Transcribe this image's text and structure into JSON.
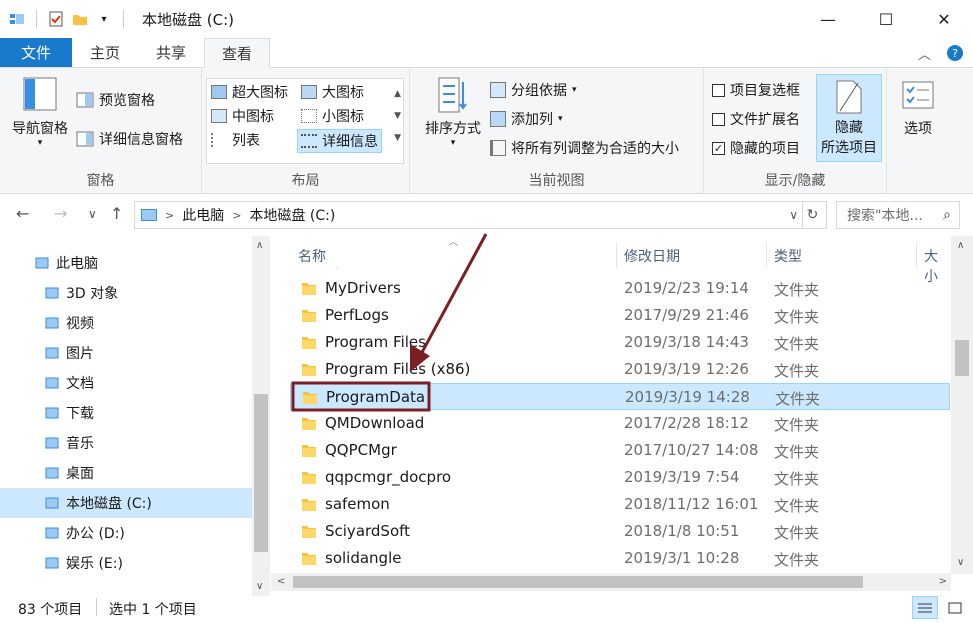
{
  "window": {
    "title": "本地磁盘 (C:)",
    "minimize": "—",
    "maximize": "☐",
    "close": "✕"
  },
  "tabs": {
    "file": "文件",
    "home": "主页",
    "share": "共享",
    "view": "查看"
  },
  "ribbon": {
    "panes": {
      "nav_pane": "导航窗格",
      "preview_pane": "预览窗格",
      "details_pane": "详细信息窗格",
      "label": "窗格"
    },
    "layout": {
      "xl_icons": "超大图标",
      "large_icons": "大图标",
      "medium_icons": "中图标",
      "small_icons": "小图标",
      "list": "列表",
      "details": "详细信息",
      "label": "布局"
    },
    "current_view": {
      "sort_by": "排序方式",
      "group_by": "分组依据",
      "add_column": "添加列",
      "size_all": "将所有列调整为合适的大小",
      "label": "当前视图"
    },
    "show_hide": {
      "item_checkboxes": "项目复选框",
      "file_ext": "文件扩展名",
      "hidden_items": "隐藏的项目",
      "hide_selected_1": "隐藏",
      "hide_selected_2": "所选项目",
      "label": "显示/隐藏",
      "item_checkboxes_checked": false,
      "file_ext_checked": false,
      "hidden_items_checked": true
    },
    "options": "选项"
  },
  "address": {
    "sep": ">",
    "crumb1": "此电脑",
    "crumb2": "本地磁盘 (C:)",
    "search_placeholder": "搜索\"本地...",
    "search_icon": "search-icon"
  },
  "tree": [
    {
      "label": "此电脑",
      "icon": "computer-icon"
    },
    {
      "label": "3D 对象",
      "icon": "3d-objects-icon"
    },
    {
      "label": "视频",
      "icon": "video-icon"
    },
    {
      "label": "图片",
      "icon": "pictures-icon"
    },
    {
      "label": "文档",
      "icon": "documents-icon"
    },
    {
      "label": "下载",
      "icon": "downloads-icon"
    },
    {
      "label": "音乐",
      "icon": "music-icon"
    },
    {
      "label": "桌面",
      "icon": "desktop-icon"
    },
    {
      "label": "本地磁盘 (C:)",
      "icon": "drive-c-icon"
    },
    {
      "label": "办公 (D:)",
      "icon": "drive-icon"
    },
    {
      "label": "娱乐 (E:)",
      "icon": "drive-icon"
    }
  ],
  "columns": {
    "name": "名称",
    "date": "修改日期",
    "type": "类型",
    "size": "大小"
  },
  "files": [
    {
      "name": "MyDrivers",
      "date": "2019/2/23 19:14",
      "type": "文件夹"
    },
    {
      "name": "PerfLogs",
      "date": "2017/9/29 21:46",
      "type": "文件夹"
    },
    {
      "name": "Program Files",
      "date": "2019/3/18 14:43",
      "type": "文件夹"
    },
    {
      "name": "Program Files (x86)",
      "date": "2019/3/19 12:26",
      "type": "文件夹"
    },
    {
      "name": "ProgramData",
      "date": "2019/3/19 14:28",
      "type": "文件夹"
    },
    {
      "name": "QMDownload",
      "date": "2017/2/28 18:12",
      "type": "文件夹"
    },
    {
      "name": "QQPCMgr",
      "date": "2017/10/27 14:08",
      "type": "文件夹"
    },
    {
      "name": "qqpcmgr_docpro",
      "date": "2019/3/19 7:54",
      "type": "文件夹"
    },
    {
      "name": "safemon",
      "date": "2018/11/12 16:01",
      "type": "文件夹"
    },
    {
      "name": "SciyardSoft",
      "date": "2018/1/8 10:51",
      "type": "文件夹"
    },
    {
      "name": "solidangle",
      "date": "2019/3/1 10:28",
      "type": "文件夹"
    }
  ],
  "status": {
    "count": "83 个项目",
    "selected": "选中 1 个项目"
  },
  "colors": {
    "accent": "#1979ca",
    "selection": "#cce8ff",
    "annotation": "#7a1f24"
  }
}
